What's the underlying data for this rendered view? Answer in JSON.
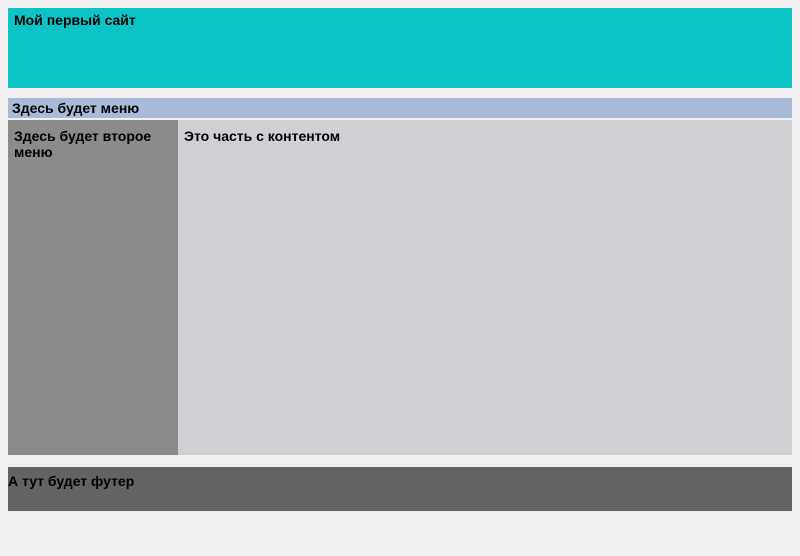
{
  "header": {
    "title": "Мой первый сайт"
  },
  "menu": {
    "label": "Здесь будет меню"
  },
  "sidebar": {
    "label": "Здесь будет второе меню"
  },
  "content": {
    "text": "Это часть с контентом"
  },
  "footer": {
    "text": "А тут будет футер"
  }
}
